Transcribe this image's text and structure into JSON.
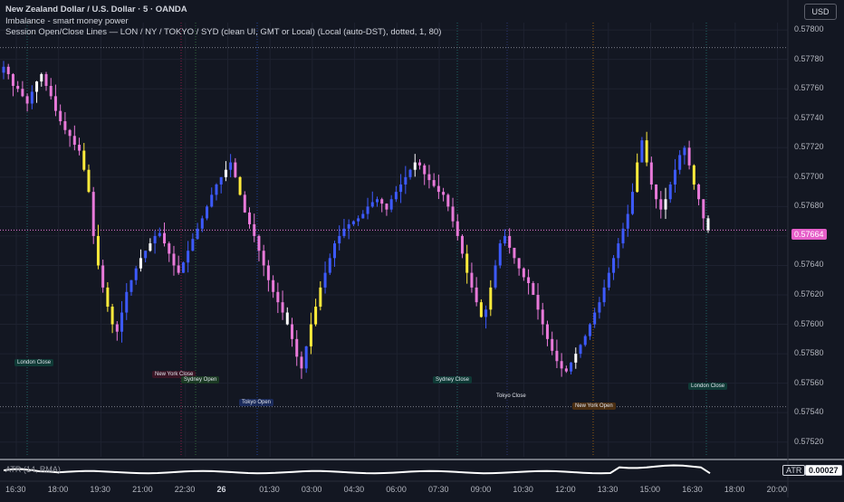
{
  "header": {
    "symbol_title": "New Zealand Dollar / U.S. Dollar · 5 · OANDA",
    "indicator_1": "Imbalance - smart money power",
    "indicator_2": "Session Open/Close Lines — LON / NY / TOKYO / SYD (clean UI, GMT or Local) (Local (auto-DST), dotted, 1, 80)"
  },
  "currency_button": "USD",
  "price_axis": {
    "labels": [
      "0.57800",
      "0.57780",
      "0.57760",
      "0.57740",
      "0.57720",
      "0.57700",
      "0.57680",
      "0.57660",
      "0.57640",
      "0.57620",
      "0.57600",
      "0.57580",
      "0.57560",
      "0.57540",
      "0.57520"
    ],
    "current_price": "0.57664"
  },
  "time_axis": {
    "labels": [
      "16:30",
      "18:00",
      "19:30",
      "21:00",
      "22:30",
      "26",
      "01:30",
      "03:00",
      "04:30",
      "06:00",
      "07:30",
      "09:00",
      "10:30",
      "12:00",
      "13:30",
      "15:00",
      "16:30",
      "18:00",
      "20:00"
    ]
  },
  "sessions": [
    {
      "label": "London Close",
      "color": "#26a69a"
    },
    {
      "label": "New York Close",
      "color": "#e91e63"
    },
    {
      "label": "Sydney Open",
      "color": "#4caf50"
    },
    {
      "label": "Tokyo Open",
      "color": "#2962ff"
    },
    {
      "label": "Sydney Close",
      "color": "#26a69a"
    },
    {
      "label": "Tokyo Close",
      "color": "#3f51b5"
    },
    {
      "label": "New York Open",
      "color": "#ff9800"
    },
    {
      "label": "London Close",
      "color": "#26a69a"
    }
  ],
  "atr": {
    "label": "ATR (14, RMA)",
    "name": "ATR",
    "value": "0.00027"
  },
  "chart_data": {
    "type": "candlestick",
    "ylim": [
      0.5751,
      0.57805
    ],
    "series_colors": {
      "up": "#3d5afe",
      "down": "#e879d9",
      "imbalance": "#ffeb3b",
      "white": "#ffffff"
    },
    "closes": [
      0.57775,
      0.5777,
      0.57762,
      0.5776,
      0.57755,
      0.5775,
      0.57758,
      0.57765,
      0.5777,
      0.57762,
      0.57755,
      0.57745,
      0.57738,
      0.57732,
      0.57728,
      0.57722,
      0.57718,
      0.57705,
      0.5769,
      0.5766,
      0.5764,
      0.57625,
      0.57612,
      0.576,
      0.57595,
      0.57608,
      0.57622,
      0.5763,
      0.57638,
      0.57645,
      0.5765,
      0.57655,
      0.5766,
      0.57662,
      0.57655,
      0.57648,
      0.5764,
      0.57635,
      0.57642,
      0.5765,
      0.57658,
      0.57665,
      0.57672,
      0.5768,
      0.57688,
      0.57695,
      0.577,
      0.57705,
      0.5771,
      0.577,
      0.57688,
      0.57676,
      0.57668,
      0.5766,
      0.5765,
      0.5764,
      0.5763,
      0.57622,
      0.57615,
      0.57608,
      0.576,
      0.5759,
      0.57578,
      0.5757,
      0.57585,
      0.576,
      0.57612,
      0.57625,
      0.57635,
      0.57645,
      0.57655,
      0.5766,
      0.57665,
      0.57668,
      0.5767,
      0.57672,
      0.57675,
      0.5768,
      0.57683,
      0.57685,
      0.57682,
      0.57678,
      0.57685,
      0.5769,
      0.57695,
      0.577,
      0.57705,
      0.5771,
      0.57708,
      0.57702,
      0.57698,
      0.57694,
      0.5769,
      0.57688,
      0.5768,
      0.5767,
      0.5766,
      0.57648,
      0.57635,
      0.57625,
      0.57615,
      0.57605,
      0.5761,
      0.57625,
      0.5764,
      0.57655,
      0.5766,
      0.57652,
      0.57645,
      0.57638,
      0.57632,
      0.57628,
      0.5762,
      0.5761,
      0.576,
      0.5759,
      0.57582,
      0.57575,
      0.5757,
      0.57568,
      0.57574,
      0.5758,
      0.57586,
      0.57592,
      0.576,
      0.57608,
      0.57615,
      0.57625,
      0.57635,
      0.57645,
      0.57655,
      0.57665,
      0.57675,
      0.5769,
      0.5771,
      0.57725,
      0.5771,
      0.57695,
      0.57685,
      0.57678,
      0.57685,
      0.57695,
      0.57705,
      0.57715,
      0.5772,
      0.57708,
      0.57695,
      0.57685,
      0.57672,
      0.57664
    ]
  }
}
